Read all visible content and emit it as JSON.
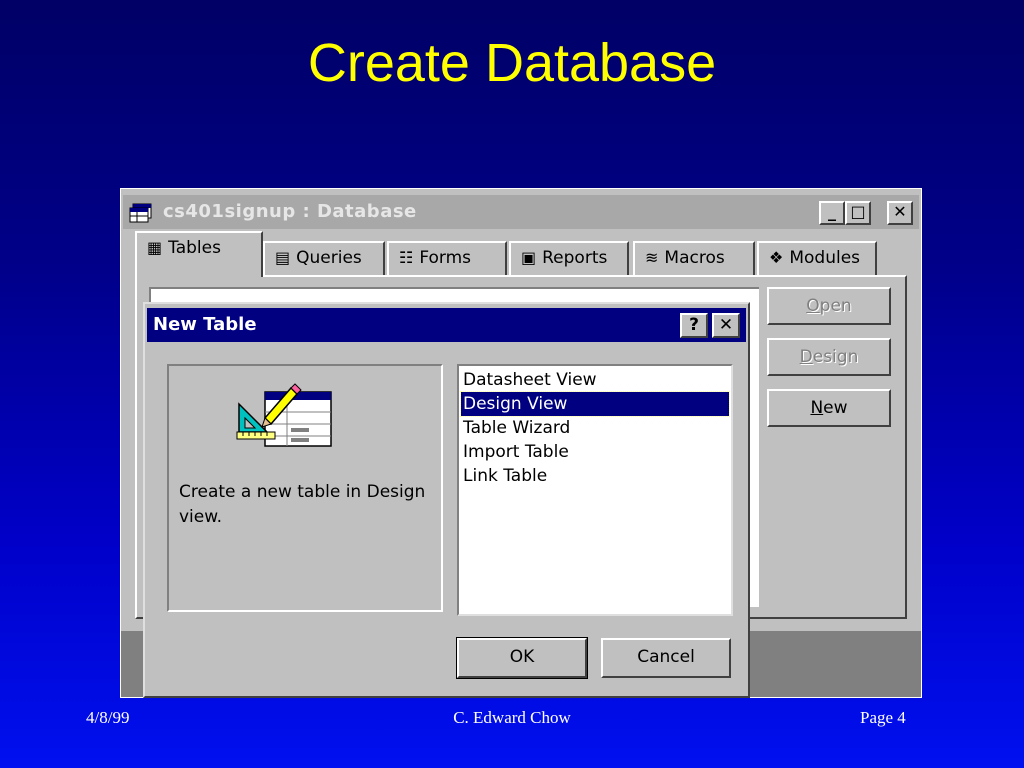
{
  "slide": {
    "title": "Create Database",
    "footer": {
      "date": "4/8/99",
      "author": "C. Edward Chow",
      "page": "Page  4"
    }
  },
  "db_window": {
    "title": "cs401signup : Database",
    "icon": "database-window-icon",
    "controls": {
      "minimize": "_",
      "maximize": "□",
      "close": "✕"
    },
    "tabs": [
      {
        "label": "Tables",
        "icon": "table-icon",
        "active": true
      },
      {
        "label": "Queries",
        "icon": "query-icon",
        "active": false
      },
      {
        "label": "Forms",
        "icon": "form-icon",
        "active": false
      },
      {
        "label": "Reports",
        "icon": "report-icon",
        "active": false
      },
      {
        "label": "Macros",
        "icon": "macro-icon",
        "active": false
      },
      {
        "label": "Modules",
        "icon": "module-icon",
        "active": false
      }
    ],
    "buttons": {
      "open": {
        "prefix": "",
        "accel": "O",
        "rest": "pen",
        "enabled": false
      },
      "design": {
        "prefix": "",
        "accel": "D",
        "rest": "esign",
        "enabled": false
      },
      "new": {
        "prefix": "",
        "accel": "N",
        "rest": "ew",
        "enabled": true
      }
    }
  },
  "dialog": {
    "title": "New Table",
    "help": "?",
    "close": "✕",
    "description": "Create a new table in Design view.",
    "icon": "table-design-icon",
    "options": [
      "Datasheet View",
      "Design View",
      "Table Wizard",
      "Import Table",
      "Link Table"
    ],
    "selected_option": "Design View",
    "ok_label": "OK",
    "cancel_label": "Cancel"
  },
  "colors": {
    "title_yellow": "#ffff00",
    "dialog_titlebar": "#000080",
    "window_face": "#c0c0c0",
    "inactive_titlebar": "#a8a8a8"
  }
}
